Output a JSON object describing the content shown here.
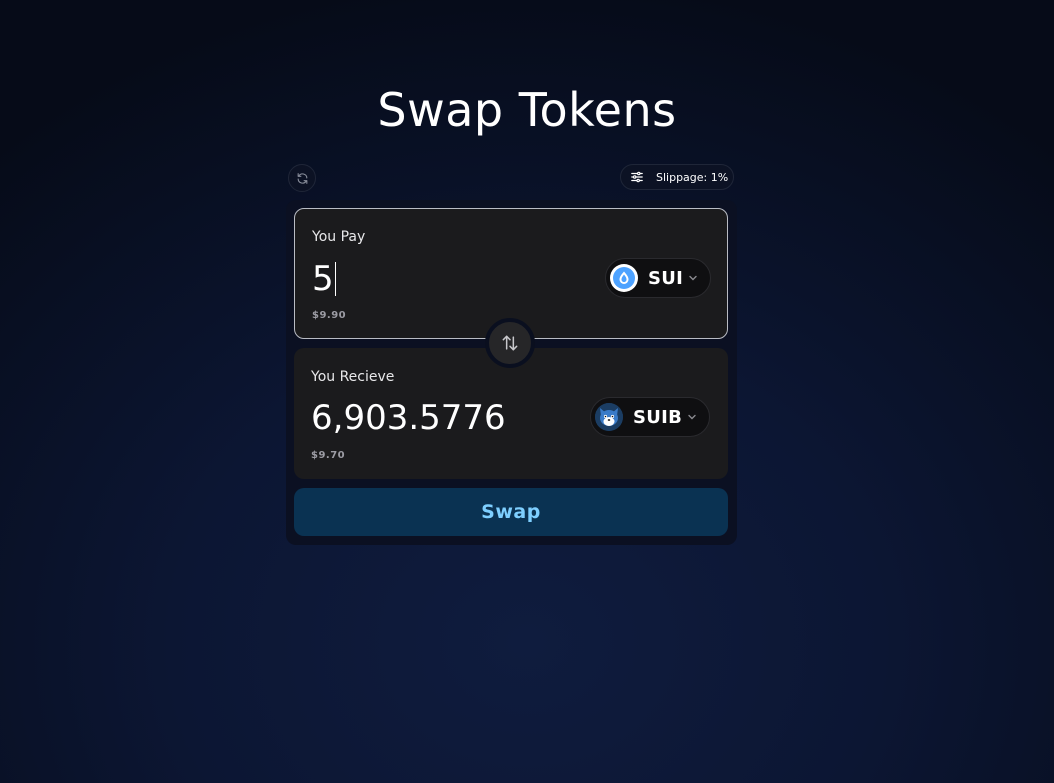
{
  "page": {
    "title": "Swap Tokens"
  },
  "toolbar": {
    "refresh_icon": "refresh-icon",
    "settings_icon": "sliders-icon",
    "slippage_label": "Slippage: 1%"
  },
  "pay": {
    "label": "You Pay",
    "amount": "5",
    "usd_value": "$9.90",
    "token": {
      "symbol": "SUI",
      "icon": "sui-droplet-icon",
      "color": "#4da2ff"
    }
  },
  "receive": {
    "label": "You Recieve",
    "amount": "6,903.5776",
    "usd_value": "$9.70",
    "token": {
      "symbol": "SUIB",
      "icon": "shiba-dog-icon"
    }
  },
  "switch": {
    "icon": "swap-arrows-icon"
  },
  "action": {
    "swap_label": "Swap"
  },
  "colors": {
    "background": "#0a1230",
    "card": "#0b1022",
    "panel": "#1b1b1d",
    "swap_button_bg": "#0a3252",
    "swap_button_text": "#7ecfff"
  }
}
